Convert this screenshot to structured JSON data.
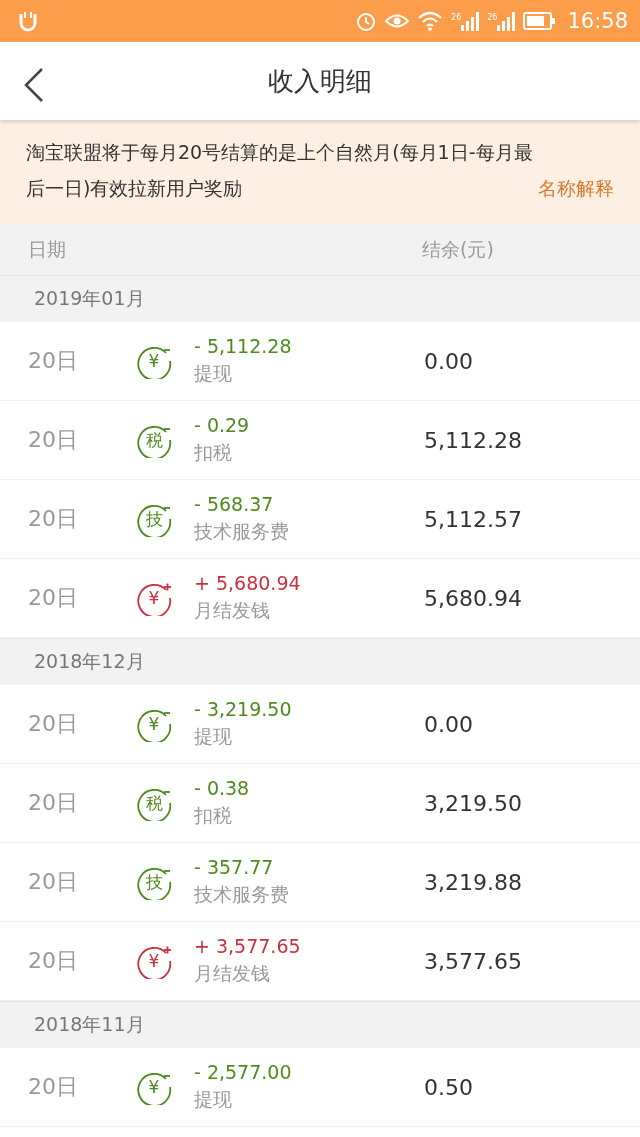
{
  "status_bar": {
    "time": "16:58",
    "signals": [
      {
        "label": "26"
      },
      {
        "label": "26"
      }
    ]
  },
  "header": {
    "title": "收入明细"
  },
  "notice": {
    "lines": [
      "淘宝联盟将于每月20号结算的是上个自然月(每月1日-每月最",
      "后一日)有效拉新用户奖励"
    ],
    "link": "名称解释"
  },
  "columns": [
    "日期",
    "结余(元)"
  ],
  "months": [
    {
      "month": "2019年01月",
      "rows": [
        {
          "day": "20日",
          "kind": "expense",
          "icon_text": "¥",
          "amount": "- 5,112.28",
          "label": "提现",
          "balance": "0.00"
        },
        {
          "day": "20日",
          "kind": "expense",
          "icon_text": "税",
          "amount": "- 0.29",
          "label": "扣税",
          "balance": "5,112.28"
        },
        {
          "day": "20日",
          "kind": "expense",
          "icon_text": "技",
          "amount": "- 568.37",
          "label": "技术服务费",
          "balance": "5,112.57"
        },
        {
          "day": "20日",
          "kind": "income",
          "icon_text": "¥",
          "amount": "+ 5,680.94",
          "label": "月结发钱",
          "balance": "5,680.94"
        }
      ]
    },
    {
      "month": "2018年12月",
      "rows": [
        {
          "day": "20日",
          "kind": "expense",
          "icon_text": "¥",
          "amount": "- 3,219.50",
          "label": "提现",
          "balance": "0.00"
        },
        {
          "day": "20日",
          "kind": "expense",
          "icon_text": "税",
          "amount": "- 0.38",
          "label": "扣税",
          "balance": "3,219.50"
        },
        {
          "day": "20日",
          "kind": "expense",
          "icon_text": "技",
          "amount": "- 357.77",
          "label": "技术服务费",
          "balance": "3,219.88"
        },
        {
          "day": "20日",
          "kind": "income",
          "icon_text": "¥",
          "amount": "+ 3,577.65",
          "label": "月结发钱",
          "balance": "3,577.65"
        }
      ]
    },
    {
      "month": "2018年11月",
      "rows": [
        {
          "day": "20日",
          "kind": "expense",
          "icon_text": "¥",
          "amount": "- 2,577.00",
          "label": "提现",
          "balance": "0.50"
        }
      ]
    }
  ]
}
